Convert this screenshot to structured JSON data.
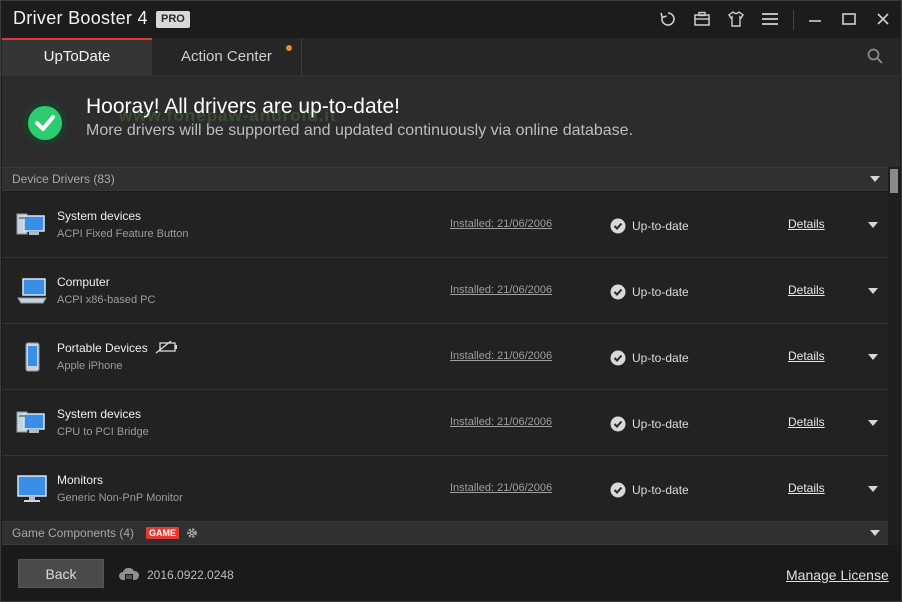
{
  "app": {
    "title": "Driver Booster 4",
    "badge": "PRO"
  },
  "titlebar_icons": [
    "restore-icon",
    "toolbox-icon",
    "skin-icon",
    "menu-icon",
    "minimize-icon",
    "maximize-icon",
    "close-icon"
  ],
  "tabs": [
    {
      "label": "UpToDate",
      "active": true
    },
    {
      "label": "Action Center",
      "active": false,
      "notification": true
    }
  ],
  "banner": {
    "title": "Hooray! All drivers are up-to-date!",
    "subtitle": "More drivers will be supported and updated continuously via online database.",
    "watermark": "www.fonepaw-android.it"
  },
  "sections": {
    "device_drivers": {
      "label": "Device Drivers (83)"
    },
    "game_components": {
      "label": "Game Components (4)",
      "badge": "GAME"
    }
  },
  "drivers": [
    {
      "name": "System devices",
      "device": "ACPI Fixed Feature Button",
      "installed": "Installed: 21/06/2006",
      "status": "Up-to-date",
      "details": "Details",
      "icon": "system-device-icon"
    },
    {
      "name": "Computer",
      "device": "ACPI x86-based PC",
      "installed": "Installed: 21/06/2006",
      "status": "Up-to-date",
      "details": "Details",
      "icon": "computer-icon"
    },
    {
      "name": "Portable Devices",
      "device": "Apple iPhone",
      "installed": "Installed: 21/06/2006",
      "status": "Up-to-date",
      "details": "Details",
      "icon": "phone-icon"
    },
    {
      "name": "System devices",
      "device": "CPU to PCI Bridge",
      "installed": "Installed: 21/06/2006",
      "status": "Up-to-date",
      "details": "Details",
      "icon": "system-device-icon"
    },
    {
      "name": "Monitors",
      "device": "Generic Non-PnP Monitor",
      "installed": "Installed: 21/06/2006",
      "status": "Up-to-date",
      "details": "Details",
      "icon": "monitor-icon"
    }
  ],
  "footer": {
    "back_label": "Back",
    "version": "2016.0922.0248",
    "manage_label": "Manage License"
  },
  "colors": {
    "accent_red": "#e53935",
    "success_green": "#2ecc71",
    "notification_orange": "#f28c28"
  }
}
